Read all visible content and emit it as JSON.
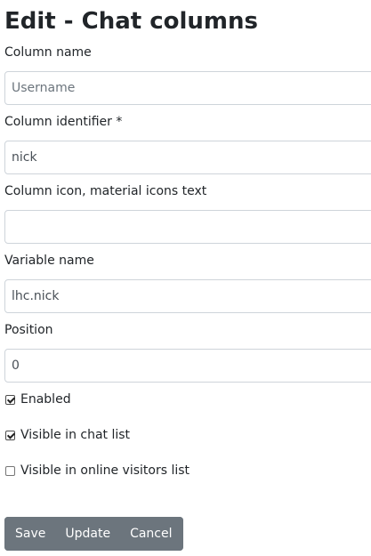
{
  "page": {
    "title": "Edit - Chat columns"
  },
  "form": {
    "column_name": {
      "label": "Column name",
      "value": "",
      "placeholder": "Username"
    },
    "column_identifier": {
      "label": "Column identifier *",
      "value": "nick"
    },
    "column_icon": {
      "label": "Column icon, material icons text",
      "value": ""
    },
    "variable_name": {
      "label": "Variable name",
      "value": "lhc.nick"
    },
    "position": {
      "label": "Position",
      "value": "0"
    },
    "checkboxes": [
      {
        "label": "Enabled",
        "checked": true
      },
      {
        "label": "Visible in chat list",
        "checked": true
      },
      {
        "label": "Visible in online visitors list",
        "checked": false
      }
    ]
  },
  "buttons": {
    "save": "Save",
    "update": "Update",
    "cancel": "Cancel"
  },
  "colors": {
    "button_bg": "#6c757d",
    "input_border": "#ced4da",
    "text": "#212529"
  }
}
